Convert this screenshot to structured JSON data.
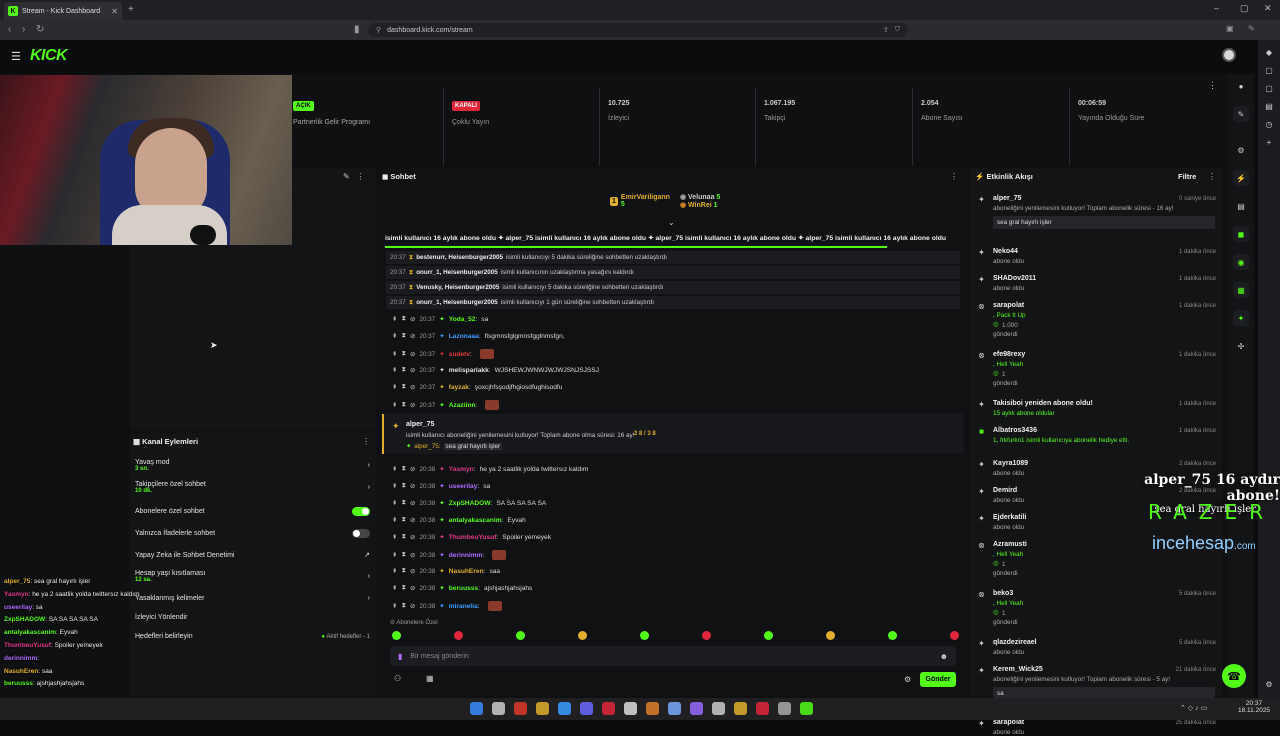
{
  "browser": {
    "tab_title": "Stream - Kick Dashboard",
    "url": "dashboard.kick.com/stream"
  },
  "brand": {
    "logo": "KICK",
    "accent": "#53fc18"
  },
  "stats": [
    {
      "value": "AÇIK",
      "label": "Partnerlik Gelir Programı",
      "tag_color": "#53fc18"
    },
    {
      "value": "KAPALI",
      "label": "Çoklu Yayın",
      "tag_color": "#e0263a"
    },
    {
      "value": "10.725",
      "label": "İzleyici"
    },
    {
      "value": "1.067.195",
      "label": "Takipçi"
    },
    {
      "value": "2.054",
      "label": "Abone Sayısı"
    },
    {
      "value": "00:06:59",
      "label": "Yayında Olduğu Süre"
    }
  ],
  "kanal": {
    "title": "Kanal Eylemleri",
    "items": [
      {
        "label": "Yavaş mod",
        "sub": "3 sn."
      },
      {
        "label": "Takipçilere özel sohbet",
        "sub": "10 dk."
      },
      {
        "label": "Abonelere özel sohbet"
      },
      {
        "label": "Yalnızca İfadelerle sohbet"
      },
      {
        "label": "Yapay Zeka ile Sohbet Denetimi"
      },
      {
        "label": "Hesap yaşı kısıtlaması",
        "sub": "12 sa."
      },
      {
        "label": "Yasaklanmış kelimeler"
      },
      {
        "label": "İzleyici Yönlendir"
      },
      {
        "label": "Hedefleri belirleyin",
        "right": "Aktif hedefler - 1"
      }
    ]
  },
  "overlay_chat": [
    {
      "user": "alper_75",
      "text": ": sea gral hayırlı işler",
      "color": "#e0b02a"
    },
    {
      "user": "Yasmyn",
      "text": ": he ya 2 saatlik yolda twittersız kaldım",
      "color": "#e03a8a"
    },
    {
      "user": "useerilay",
      "text": ": sa",
      "color": "#b06bff"
    },
    {
      "user": "ZxpSHADOW",
      "text": ": SA SA SA SA SA",
      "color": "#53fc18"
    },
    {
      "user": "antalyakascanim",
      "text": ": Eyvah",
      "color": "#53fc18"
    },
    {
      "user": "ThumbeuYusuf",
      "text": ": Spoiler yemeyek",
      "color": "#e03a8a"
    },
    {
      "user": "derinnimm",
      "text": ":",
      "color": "#b06bff"
    },
    {
      "user": "NasuhEren",
      "text": ": saa",
      "color": "#e0b02a"
    },
    {
      "user": "beruusss",
      "text": ": ajshjashjahsjahs",
      "color": "#53fc18"
    }
  ],
  "chat": {
    "title": "Sohbet",
    "leaders": [
      {
        "name": "EmirVariligann",
        "count": "5",
        "rank": "1"
      },
      {
        "name": "Velunaa",
        "count": "5"
      },
      {
        "name": "WinRei",
        "count": "1"
      }
    ],
    "ticker": "isimli kullanıcı 16 aylık abone oldu  ✦ alper_75 isimli kullanıcı 16 aylık abone oldu  ✦ alper_75 isimli kullanıcı 16 aylık abone oldu  ✦ alper_75 isimli kullanıcı 16 aylık abone oldu",
    "mod_rows": [
      {
        "time": "20:37",
        "users": "bestenurr, Heisenburger2005",
        "text": "isimli kullanıcıyı 5 dakika süreliğine sohbetten uzaklaştırdı"
      },
      {
        "time": "20:37",
        "users": "onurr_1, Heisenburger2005",
        "text": "isimli kullanıcının uzaklaştırma yasağını kaldırdı"
      },
      {
        "time": "20:37",
        "users": "Venusky, Heisenburger2005",
        "text": "isimli kullanıcıyı 5 dakika süreliğine sohbetten uzaklaştırdı"
      },
      {
        "time": "20:37",
        "users": "onurr_1, Heisenburger2005",
        "text": "isimli kullanıcıyı 1 gün süreliğine sohbetten uzaklaştırdı"
      }
    ],
    "messages_a": [
      {
        "time": "20:37",
        "user": "Yoda_52",
        "text": "sa",
        "color": "#53fc18"
      },
      {
        "time": "20:37",
        "user": "Lazonaaa",
        "text": "flsgmnsfglgmnsfgglnmsfgn,",
        "color": "#3a9cff"
      },
      {
        "time": "20:37",
        "user": "sudetv",
        "text": "",
        "color": "#e03a3a"
      },
      {
        "time": "20:37",
        "user": "melisparlakk",
        "text": "WJSHEWJWNWJWJWJSNJSJSSJ",
        "color": "#e0e0e0"
      },
      {
        "time": "20:37",
        "user": "fayzak",
        "text": "şoxcjhfsşodjfhgiosdfughisodfu",
        "color": "#e0b02a"
      },
      {
        "time": "20:37",
        "user": "Azaziinn",
        "text": "",
        "color": "#53fc18"
      }
    ],
    "sub_card": {
      "user": "alper_75",
      "text": "isimli kullanıcı aboneliğini yenilemesini kutluyor! Toplam abone olma süresi: 16 ay!",
      "badge": "2 8 / 3 8",
      "reply_user": "alper_75:",
      "reply_text": "sea gral hayırlı işler"
    },
    "messages_b": [
      {
        "time": "20:38",
        "user": "Yasmyn",
        "text": "he ya 2 saatlik yolda twittersız kaldım",
        "color": "#e03a8a"
      },
      {
        "time": "20:38",
        "user": "useerilay",
        "text": "sa",
        "color": "#b06bff"
      },
      {
        "time": "20:38",
        "user": "ZxpSHADOW",
        "text": "SA SA SA SA SA",
        "color": "#53fc18"
      },
      {
        "time": "20:38",
        "user": "antalyakascanim",
        "text": "Eyvah",
        "color": "#53fc18"
      },
      {
        "time": "20:38",
        "user": "ThumbeuYusuf",
        "text": "Spoiler yemeyek",
        "color": "#e03a8a"
      },
      {
        "time": "20:38",
        "user": "derinnimm",
        "text": "",
        "color": "#b06bff"
      },
      {
        "time": "20:38",
        "user": "NasuhEren",
        "text": "saa",
        "color": "#e0b02a"
      },
      {
        "time": "20:38",
        "user": "beruusss",
        "text": "ajshjashjahsjahs",
        "color": "#53fc18"
      },
      {
        "time": "20:38",
        "user": "miranelia",
        "text": "",
        "color": "#3a9cff"
      }
    ],
    "sub_only_label": "Abonelere Özel",
    "input_placeholder": "Bir mesaj gönderin",
    "send_label": "Gönder"
  },
  "activity": {
    "title": "Etkinlik Akışı",
    "filter": "Filtre",
    "items": [
      {
        "name": "alper_75",
        "desc": "aboneliğini yenilemesini kutluyor! Toplam abonelik süresi - 16 ay!",
        "time": "0 saniye önce",
        "quote": "sea gral hayırlı işler",
        "icon": "✦"
      },
      {
        "name": "Neko44",
        "desc": "abone oldu",
        "time": "1 dakika önce",
        "icon": "✦"
      },
      {
        "name": "SHADov2011",
        "desc": "abone oldu",
        "time": "1 dakika önce",
        "icon": "✦"
      },
      {
        "name": "sarapolat",
        "desc": ", Pack It Up",
        "amount": "1.000",
        "desc2": "gönderdi",
        "time": "1 dakika önce",
        "icon": "⊗"
      },
      {
        "name": "efe98rexy",
        "desc": ", Hell Yeah",
        "amount": "1",
        "desc2": "gönderdi",
        "time": "1 dakika önce",
        "icon": "⊗"
      },
      {
        "name": "Takisiboi yeniden abone oldu!",
        "desc": "15 aylık abone oldular",
        "time": "1 dakika önce",
        "icon": "✦"
      },
      {
        "name": "Albatros3436",
        "desc": "1, frkfurkn1 isimli kullanıcıya abonelik hediye etti.",
        "time": "1 dakika önce",
        "icon": "■"
      },
      {
        "name": "Kayra1089",
        "desc": "abone oldu",
        "time": "2 dakika önce",
        "icon": "✦"
      },
      {
        "name": "Demird",
        "desc": "abone oldu",
        "time": "2 dakika önce",
        "icon": "✦"
      },
      {
        "name": "Ejderkatili",
        "desc": "abone oldu",
        "time": "",
        "icon": "✦"
      },
      {
        "name": "Azramusti",
        "desc": ", Hell Yeah",
        "amount": "1",
        "desc2": "gönderdi",
        "time": "",
        "icon": "⊗"
      },
      {
        "name": "beko3",
        "desc": ", Hell Yeah",
        "amount": "1",
        "desc2": "gönderdi",
        "time": "5 dakika önce",
        "icon": "⊗"
      },
      {
        "name": "qlazdezireael",
        "desc": "abone oldu",
        "time": "5 dakika önce",
        "icon": "✦"
      },
      {
        "name": "Kerem_Wick25",
        "desc": "aboneliğini yenilemesini kutluyor! Toplam abonelik süresi - 5 ay!",
        "time": "21 dakika önce",
        "quote": "sa",
        "icon": "✦"
      },
      {
        "name": "sarapolat",
        "desc": "abone oldu",
        "time": "25 dakika önce",
        "icon": "✦"
      }
    ]
  },
  "overlay": {
    "sub_line": "alper_75 16 aydır abone!",
    "sub_msg": "sea gral hayırlı işler",
    "razer": "RAZER",
    "incehesap": "incehesap",
    "incehesap_tld": ".com"
  },
  "taskbar": {
    "time": "20:37",
    "date": "18.11.2025"
  }
}
